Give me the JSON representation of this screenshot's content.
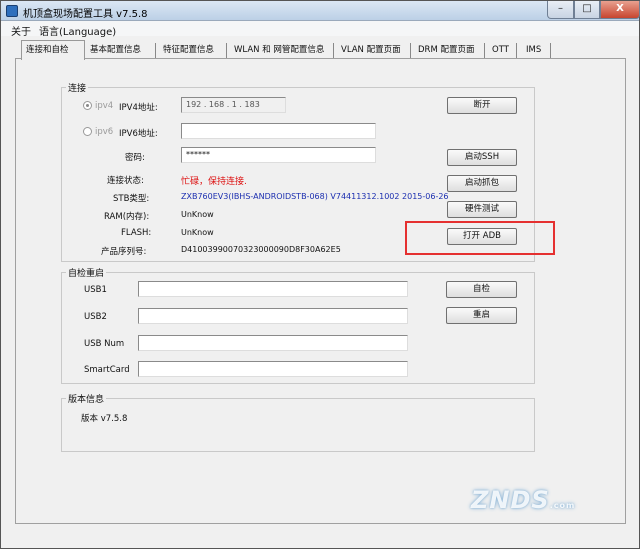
{
  "window": {
    "title": "机顶盒现场配置工具 v7.5.8",
    "minimize": "–",
    "maximize": "□",
    "close": "X"
  },
  "menu": [
    "关于",
    "语言(Language)"
  ],
  "tabs": [
    "连接和自检",
    "基本配置信息",
    "特征配置信息",
    "WLAN 和 网管配置信息",
    "VLAN 配置页面",
    "DRM 配置页面",
    "OTT",
    "IMS"
  ],
  "connection": {
    "group_label": "连接",
    "ipv4_radio": "ipv4",
    "ipv4_label": "IPV4地址:",
    "ipv4_value": "192 . 168 . 1 . 183",
    "ipv6_radio": "ipv6",
    "ipv6_label": "IPV6地址:",
    "ipv6_value": "",
    "password_label": "密码:",
    "password_value": "******",
    "status_label": "连接状态:",
    "status_value": "忙碌，保持连接.",
    "stb_label": "STB类型:",
    "stb_value": "ZXB760EV3(IBHS-ANDROIDSTB-068) V74411312.1002 2015-06-26",
    "ram_label": "RAM(内存):",
    "ram_value": "UnKnow",
    "flash_label": "FLASH:",
    "flash_value": "UnKnow",
    "serial_label": "产品序列号:",
    "serial_value": "D41003990070323000090D8F30A62E5",
    "buttons": {
      "disconnect": "断开",
      "start_ssh": "启动SSH",
      "start_capture": "启动抓包",
      "hardware_test": "硬件测试",
      "open_adb": "打开 ADB"
    },
    "highlight_color": "#e53030"
  },
  "selfcheck": {
    "group_label": "自检重启",
    "usb1_label": "USB1",
    "usb2_label": "USB2",
    "usbnum_label": "USB Num",
    "smartcard_label": "SmartCard",
    "usb1_value": "",
    "usb2_value": "",
    "usbnum_value": "",
    "smartcard_value": "",
    "selfcheck_button": "自检",
    "restart_button": "重启"
  },
  "version": {
    "group_label": "版本信息",
    "text": "版本 v7.5.8"
  },
  "watermark": {
    "text": "ZNDS",
    "sub": ".com"
  }
}
